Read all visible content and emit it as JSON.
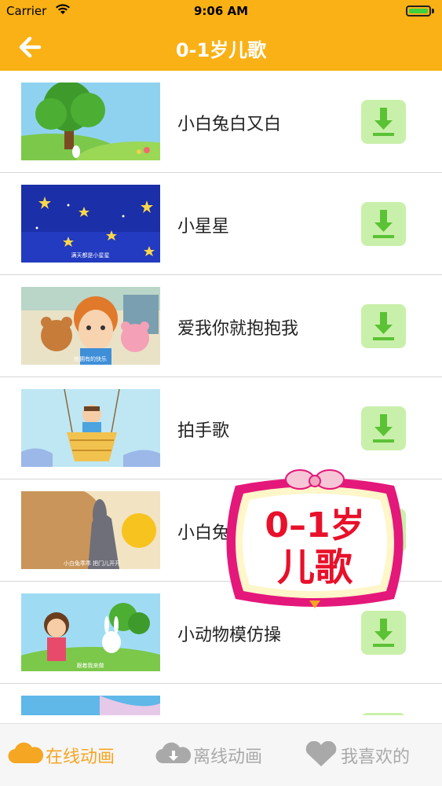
{
  "status_bar": {
    "carrier": "Carrier",
    "time": "9:06 AM"
  },
  "nav": {
    "title": "0-1岁儿歌",
    "back_icon": "arrow-left-icon"
  },
  "songs": [
    {
      "title": "小白兔白又白",
      "thumb_caption": ""
    },
    {
      "title": "小星星",
      "thumb_caption": "满天都是小星星"
    },
    {
      "title": "爱我你就抱抱我",
      "thumb_caption": "他拥有的快乐"
    },
    {
      "title": "拍手歌",
      "thumb_caption": ""
    },
    {
      "title": "小白兔",
      "thumb_caption": "小白兔乖乖 把门儿开开"
    },
    {
      "title": "小动物模仿操",
      "thumb_caption": "跟着我来做"
    },
    {
      "title": "",
      "thumb_caption": ""
    }
  ],
  "badge": {
    "line1": "0–1岁",
    "line2": "儿歌"
  },
  "tabs": [
    {
      "label": "在线动画",
      "icon": "cloud-icon",
      "active": true
    },
    {
      "label": "离线动画",
      "icon": "cloud-download-icon",
      "active": false
    },
    {
      "label": "我喜欢的",
      "icon": "heart-icon",
      "active": false
    }
  ],
  "colors": {
    "header": "#F9B115",
    "active_tab": "#F5A623",
    "inactive_tab": "#A9A9A9",
    "download_bg": "#C9F0AA",
    "download_icon": "#5BC236",
    "badge_text": "#E8102A",
    "badge_border": "#E4187A"
  }
}
